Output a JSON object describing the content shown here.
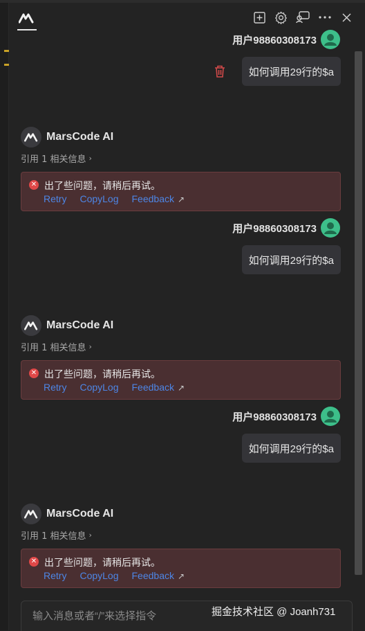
{
  "header": {
    "icons": [
      "new-chat-icon",
      "settings-icon",
      "feedback-icon",
      "more-icon",
      "close-icon"
    ]
  },
  "user": {
    "name": "用户98860308173"
  },
  "assistant": {
    "name": "MarsCode AI"
  },
  "conversation": [
    {
      "question": "如何调用29行的$a",
      "reference": "引用 1 相关信息",
      "error": {
        "message": "出了些问题，请稍后再试。",
        "retry": "Retry",
        "copylog": "CopyLog",
        "feedback": "Feedback"
      }
    },
    {
      "question": "如何调用29行的$a",
      "reference": "引用 1 相关信息",
      "error": {
        "message": "出了些问题，请稍后再试。",
        "retry": "Retry",
        "copylog": "CopyLog",
        "feedback": "Feedback"
      }
    },
    {
      "question": "如何调用29行的$a",
      "reference": "引用 1 相关信息",
      "error": {
        "message": "出了些问题，请稍后再试。",
        "retry": "Retry",
        "copylog": "CopyLog",
        "feedback": "Feedback"
      }
    }
  ],
  "input": {
    "placeholder": "输入消息或者“/”来选择指令"
  },
  "watermark": "掘金技术社区 @ Joanh731",
  "colors": {
    "accent_link": "#4d86e6",
    "error_bg": "#4a2f31",
    "avatar_green": "#3dbf8a",
    "error_icon": "#e04848"
  }
}
